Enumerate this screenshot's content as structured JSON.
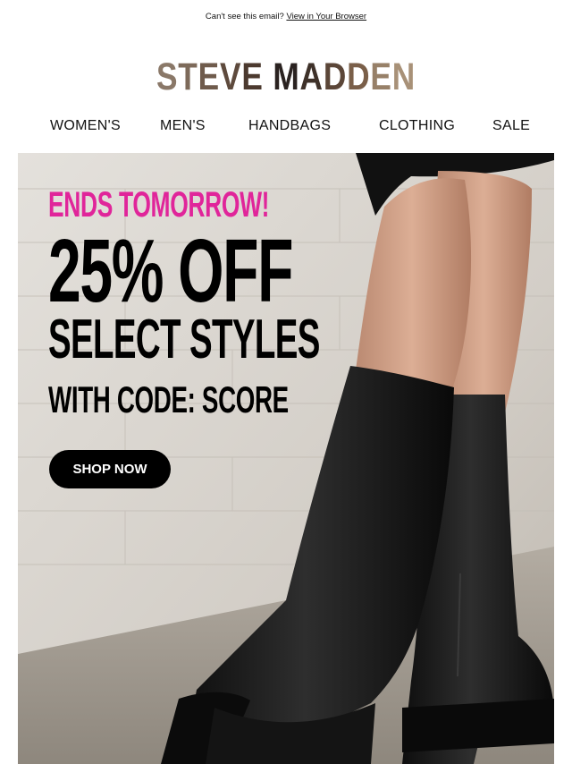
{
  "preheader": {
    "text": "Can't see this email?",
    "link": "View in Your Browser"
  },
  "brand": {
    "letters": [
      "S",
      "T",
      "E",
      "V",
      "E",
      " ",
      "M",
      "A",
      "D",
      "D",
      "E",
      "N"
    ],
    "letter_colors": [
      "#8a7868",
      "#7d6a5a",
      "#6f5b4c",
      "#5e4a3d",
      "#4c3a2f",
      "#000000",
      "#2a2220",
      "#3e3129",
      "#5b4638",
      "#7a5f49",
      "#978068",
      "#a89178"
    ]
  },
  "nav": {
    "items": [
      "WOMEN'S",
      "MEN'S",
      "HANDBAGS",
      "CLOTHING",
      "SALE"
    ]
  },
  "hero": {
    "eyebrow": "ENDS TOMORROW!",
    "headline": "25% OFF",
    "subhead": "SELECT STYLES",
    "code_line": "WITH CODE: SCORE",
    "cta": "SHOP NOW",
    "eyebrow_color": "#e0259a"
  }
}
